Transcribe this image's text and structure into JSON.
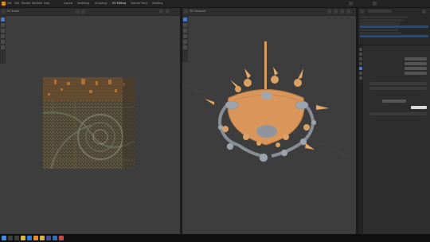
{
  "app": {
    "title": "Blender",
    "menu": [
      "File",
      "Edit",
      "Render",
      "Window",
      "Help"
    ],
    "workspace_tabs": [
      "Layout",
      "Modeling",
      "Sculpting",
      "UV Editing",
      "Texture Paint",
      "Shading"
    ]
  },
  "uv_editor": {
    "header_label": "UV Editor",
    "tools": [
      "select-icon",
      "move-icon",
      "rotate-icon",
      "scale-icon",
      "annotate-icon",
      "grab-icon"
    ]
  },
  "viewport": {
    "header_label": "3D Viewport"
  },
  "outliner": {
    "rows": 7
  },
  "colors": {
    "accent": "#4d7ac8",
    "viewport_bg": "#3d3d3d",
    "uv_bg": "#3e3e3e",
    "panel_bg": "#2d2d2d",
    "taskbar_bg": "#101010",
    "chandelier_body": "#d9955a",
    "chandelier_metal": "#9aa0a8"
  },
  "taskbar": {
    "icons": [
      "start-icon",
      "search-icon",
      "taskview-icon",
      "explorer-icon",
      "browser-icon",
      "blender-icon",
      "folder-icon",
      "store-icon",
      "mail-icon",
      "media-icon"
    ],
    "time": "",
    "date": ""
  }
}
